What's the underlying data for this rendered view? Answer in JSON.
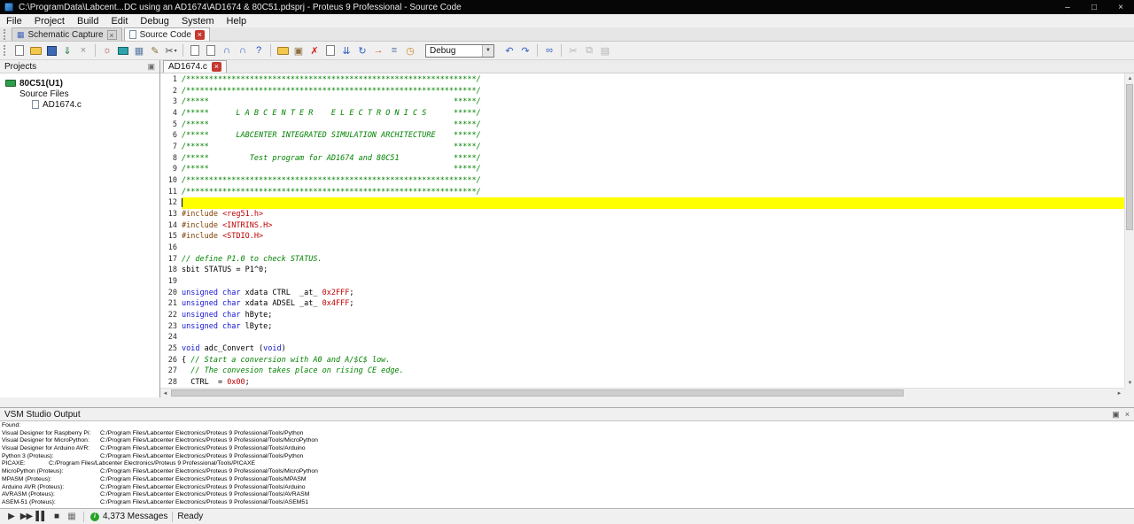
{
  "window": {
    "title": "C:\\ProgramData\\Labcent...DC using an AD1674\\AD1674 & 80C51.pdsprj - Proteus 9 Professional - Source Code"
  },
  "icons": {
    "minimize": "–",
    "maximize": "□",
    "close": "×",
    "float": "▣",
    "schematic": "▦",
    "scroll_up": "▲",
    "scroll_down": "▼",
    "scroll_left": "◄",
    "scroll_right": "►",
    "info": "i"
  },
  "menu": {
    "items": [
      "File",
      "Project",
      "Build",
      "Edit",
      "Debug",
      "System",
      "Help"
    ]
  },
  "app_tabs": [
    {
      "label": "Schematic Capture",
      "active": false
    },
    {
      "label": "Source Code",
      "active": true
    }
  ],
  "toolbar": {
    "items": [
      {
        "name": "new-file-icon",
        "shape": "page"
      },
      {
        "name": "open-project-icon",
        "shape": "folder"
      },
      {
        "name": "save-project-icon",
        "shape": "floppy"
      },
      {
        "name": "import-icon",
        "glyph": "⇓",
        "color": "#208040"
      },
      {
        "name": "close-project-icon",
        "glyph": "×",
        "color": "#8f8f8f"
      },
      {
        "sep": true
      },
      {
        "name": "settings-gear-icon",
        "glyph": "☼",
        "color": "#b04848"
      },
      {
        "name": "display-icon",
        "shape": "display"
      },
      {
        "name": "keypad-icon",
        "glyph": "▦",
        "color": "#5878a0"
      },
      {
        "name": "edit-pencil-icon",
        "glyph": "✎",
        "color": "#8a6d2f"
      },
      {
        "name": "cut-tool-icon",
        "glyph": "✂",
        "color": "#444444",
        "dropdown": true
      },
      {
        "sep": true
      },
      {
        "name": "add-file-icon",
        "shape": "page"
      },
      {
        "name": "remove-file-icon",
        "shape": "page"
      },
      {
        "name": "magnet-icon",
        "glyph": "∩",
        "color": "#3060c0"
      },
      {
        "name": "snap-magnet-icon",
        "glyph": "∩",
        "color": "#3060c0"
      },
      {
        "name": "help-icon",
        "glyph": "?",
        "color": "#2050c0"
      },
      {
        "sep": true
      },
      {
        "name": "new-folder-icon",
        "shape": "folder"
      },
      {
        "name": "build-icon",
        "glyph": "▣",
        "color": "#907040"
      },
      {
        "name": "clean-icon",
        "glyph": "✗",
        "color": "#d02020"
      },
      {
        "name": "source-file-icon",
        "shape": "page"
      },
      {
        "name": "build-all-icon",
        "glyph": "⇊",
        "color": "#3060c0"
      },
      {
        "name": "rebuild-icon",
        "glyph": "↻",
        "color": "#3060c0"
      },
      {
        "name": "flash-icon",
        "glyph": "→",
        "color": "#d06020"
      },
      {
        "name": "list-icon",
        "glyph": "≡",
        "color": "#5878a0"
      },
      {
        "name": "clock-icon",
        "glyph": "◷",
        "color": "#d08020"
      },
      {
        "name": "debug-combo",
        "combo": true,
        "value": "Debug"
      },
      {
        "name": "undo-icon",
        "glyph": "↶",
        "color": "#3060c0"
      },
      {
        "name": "redo-icon",
        "glyph": "↷",
        "color": "#3060c0"
      },
      {
        "sep": true
      },
      {
        "name": "find-icon",
        "glyph": "∞",
        "color": "#3060c0"
      },
      {
        "sep": true
      },
      {
        "name": "cut-icon",
        "glyph": "✂",
        "color": "#b2b2b2"
      },
      {
        "name": "copy-icon",
        "glyph": "⧉",
        "color": "#b2b2b2"
      },
      {
        "name": "paste-icon",
        "glyph": "▤",
        "color": "#b2b2b2"
      }
    ]
  },
  "projects_panel": {
    "title": "Projects",
    "tree": [
      {
        "label": "80C51(U1)"
      },
      {
        "label": "Source Files"
      },
      {
        "label": "AD1674.c"
      }
    ]
  },
  "editor": {
    "file_tab": "AD1674.c",
    "current_line": 12,
    "colors": {
      "comment": "#008200",
      "keyword": "#1414d2",
      "preprocessor": "#804000",
      "header": "#c00000",
      "number": "#c00000",
      "plain": "#000000",
      "current_line": "#ffff00",
      "tab_close_red": "#c4392f"
    },
    "lines": [
      {
        "n": 1,
        "segs": [
          [
            "c",
            "/****************************************************************/"
          ]
        ]
      },
      {
        "n": 2,
        "segs": [
          [
            "c",
            "/****************************************************************/"
          ]
        ]
      },
      {
        "n": 3,
        "segs": [
          [
            "c",
            "/*****                                                      *****/"
          ]
        ]
      },
      {
        "n": 4,
        "segs": [
          [
            "c",
            "/*****      L A B C E N T E R    E L E C T R O N I C S      *****/"
          ]
        ]
      },
      {
        "n": 5,
        "segs": [
          [
            "c",
            "/*****                                                      *****/"
          ]
        ]
      },
      {
        "n": 6,
        "segs": [
          [
            "c",
            "/*****      LABCENTER INTEGRATED SIMULATION ARCHITECTURE    *****/"
          ]
        ]
      },
      {
        "n": 7,
        "segs": [
          [
            "c",
            "/*****                                                      *****/"
          ]
        ]
      },
      {
        "n": 8,
        "segs": [
          [
            "c",
            "/*****         Test program for AD1674 and 80C51            *****/"
          ]
        ]
      },
      {
        "n": 9,
        "segs": [
          [
            "c",
            "/*****                                                      *****/"
          ]
        ]
      },
      {
        "n": 10,
        "segs": [
          [
            "c",
            "/****************************************************************/"
          ]
        ]
      },
      {
        "n": 11,
        "segs": [
          [
            "c",
            "/****************************************************************/"
          ]
        ]
      },
      {
        "n": 12,
        "segs": []
      },
      {
        "n": 13,
        "segs": [
          [
            "p",
            "#include "
          ],
          [
            "s",
            "<reg51.h>"
          ]
        ]
      },
      {
        "n": 14,
        "segs": [
          [
            "p",
            "#include "
          ],
          [
            "s",
            "<INTRINS.H>"
          ]
        ]
      },
      {
        "n": 15,
        "segs": [
          [
            "p",
            "#include "
          ],
          [
            "s",
            "<STDIO.H>"
          ]
        ]
      },
      {
        "n": 16,
        "segs": []
      },
      {
        "n": 17,
        "segs": [
          [
            "c",
            "// define P1.0 to check STATUS."
          ]
        ]
      },
      {
        "n": 18,
        "segs": [
          [
            "t",
            "sbit STATUS = P1^0;"
          ]
        ]
      },
      {
        "n": 19,
        "segs": []
      },
      {
        "n": 20,
        "segs": [
          [
            "k",
            "unsigned char"
          ],
          [
            "t",
            " xdata CTRL  _at_ "
          ],
          [
            "n",
            "0x2FFF"
          ],
          [
            "t",
            ";"
          ]
        ]
      },
      {
        "n": 21,
        "segs": [
          [
            "k",
            "unsigned char"
          ],
          [
            "t",
            " xdata ADSEL _at_ "
          ],
          [
            "n",
            "0x4FFF"
          ],
          [
            "t",
            ";"
          ]
        ]
      },
      {
        "n": 22,
        "segs": [
          [
            "k",
            "unsigned char"
          ],
          [
            "t",
            " hByte;"
          ]
        ]
      },
      {
        "n": 23,
        "segs": [
          [
            "k",
            "unsigned char"
          ],
          [
            "t",
            " lByte;"
          ]
        ]
      },
      {
        "n": 24,
        "segs": []
      },
      {
        "n": 25,
        "segs": [
          [
            "k",
            "void"
          ],
          [
            "t",
            " adc_Convert ("
          ],
          [
            "k",
            "void"
          ],
          [
            "t",
            ")"
          ]
        ]
      },
      {
        "n": 26,
        "segs": [
          [
            "t",
            "{ "
          ],
          [
            "c",
            "// Start a conversion with A0 and A/$C$ low."
          ]
        ]
      },
      {
        "n": 27,
        "segs": [
          [
            "t",
            "  "
          ],
          [
            "c",
            "// The convesion takes place on rising CE edge."
          ]
        ]
      },
      {
        "n": 28,
        "segs": [
          [
            "t",
            "  CTRL  = "
          ],
          [
            "n",
            "0x00"
          ],
          [
            "t",
            ";"
          ]
        ]
      }
    ]
  },
  "output_panel": {
    "title": "VSM Studio Output",
    "lines": [
      {
        "label": "Found:",
        "path": ""
      },
      {
        "label": "Visual Designer for Raspberry Pi:",
        "path": "C:/Program Files/Labcenter Electronics/Proteus 9 Professional/Tools/Python"
      },
      {
        "label": "Visual Designer for MicroPython:",
        "path": "C:/Program Files/Labcenter Electronics/Proteus 9 Professional/Tools/MicroPython"
      },
      {
        "label": "Visual Designer for Arduino AVR:",
        "path": "C:/Program Files/Labcenter Electronics/Proteus 9 Professional/Tools/Arduino"
      },
      {
        "label": "Python 3 (Proteus):",
        "path": "C:/Program Files/Labcenter Electronics/Proteus 9 Professional/Tools/Python"
      },
      {
        "label": "PICAXE:",
        "path": "C:/Program Files/Labcenter Electronics/Proteus 9 Professional/Tools/PICAXE",
        "narrow": true
      },
      {
        "label": "MicroPython (Proteus):",
        "path": "C:/Program Files/Labcenter Electronics/Proteus 9 Professional/Tools/MicroPython"
      },
      {
        "label": "MPASM (Proteus):",
        "path": "C:/Program Files/Labcenter Electronics/Proteus 9 Professional/Tools/MPASM"
      },
      {
        "label": "Arduino AVR (Proteus):",
        "path": "C:/Program Files/Labcenter Electronics/Proteus 9 Professional/Tools/Arduino"
      },
      {
        "label": "AVRASM (Proteus):",
        "path": "C:/Program Files/Labcenter Electronics/Proteus 9 Professional/Tools/AVRASM"
      },
      {
        "label": "ASEM-51 (Proteus):",
        "path": "C:/Program Files/Labcenter Electronics/Proteus 9 Professional/Tools/ASEM51"
      }
    ]
  },
  "status_bar": {
    "messages_count": "4,373 Messages",
    "ready_label": "Ready",
    "icons": [
      {
        "name": "run-icon",
        "glyph": "▶",
        "color": "#303030"
      },
      {
        "name": "step-icon",
        "glyph": "▶▶",
        "color": "#303030"
      },
      {
        "name": "pause-icon",
        "glyph": "▌▌",
        "color": "#303030"
      },
      {
        "name": "stop-icon",
        "glyph": "■",
        "color": "#303030"
      },
      {
        "name": "log-icon",
        "glyph": "▦",
        "color": "#6f6f6f"
      }
    ]
  }
}
